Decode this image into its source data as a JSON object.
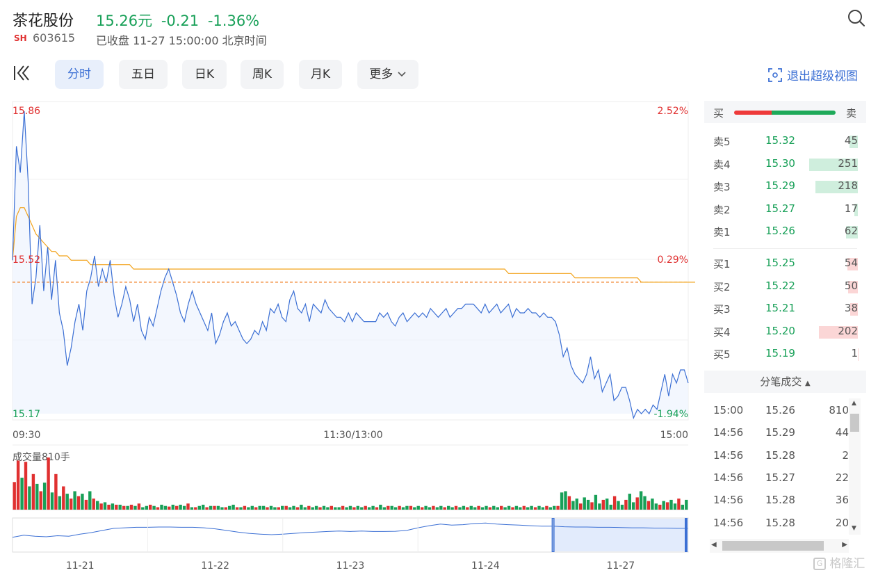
{
  "header": {
    "name": "茶花股份",
    "price": "15.26元",
    "change": "-0.21",
    "change_pct": "-1.36%",
    "exchange": "SH",
    "code": "603615",
    "status": "已收盘 11-27 15:00:00 北京时间"
  },
  "tabs": [
    "分时",
    "五日",
    "日K",
    "周K",
    "月K",
    "更多"
  ],
  "exit_label": "退出超级视图",
  "colors": {
    "up": "#e03030",
    "down": "#18a058",
    "line": "#3b6fd4",
    "avg": "#f2a31b"
  },
  "chart_data": [
    {
      "type": "line",
      "title": "",
      "y_labels_left": [
        "15.86",
        "15.52",
        "15.17"
      ],
      "y_labels_right": [
        "2.52%",
        "0.29%",
        "-1.94%"
      ],
      "ylim": [
        15.17,
        15.86
      ],
      "prev_close": 15.47,
      "x_ticks": [
        "09:30",
        "11:30/13:00",
        "15:00"
      ],
      "series": [
        {
          "values": [
            15.52,
            15.78,
            15.72,
            15.86,
            15.7,
            15.42,
            15.48,
            15.6,
            15.45,
            15.55,
            15.43,
            15.52,
            15.4,
            15.36,
            15.28,
            15.32,
            15.38,
            15.42,
            15.36,
            15.45,
            15.48,
            15.53,
            15.46,
            15.5,
            15.47,
            15.52,
            15.44,
            15.39,
            15.42,
            15.46,
            15.43,
            15.38,
            15.42,
            15.36,
            15.34,
            15.39,
            15.37,
            15.41,
            15.45,
            15.48,
            15.5,
            15.47,
            15.44,
            15.4,
            15.38,
            15.42,
            15.45,
            15.42,
            15.4,
            15.38,
            15.36,
            15.4,
            15.33,
            15.35,
            15.38,
            15.4,
            15.37,
            15.38,
            15.36,
            15.34,
            15.33,
            15.34,
            15.36,
            15.35,
            15.38,
            15.36,
            15.41,
            15.4,
            15.42,
            15.39,
            15.38,
            15.43,
            15.45,
            15.41,
            15.4,
            15.42,
            15.38,
            15.42,
            15.41,
            15.4,
            15.43,
            15.41,
            15.4,
            15.39,
            15.39,
            15.38,
            15.4,
            15.38,
            15.4,
            15.39,
            15.38,
            15.38,
            15.38,
            15.38,
            15.4,
            15.39,
            15.4,
            15.38,
            15.37,
            15.39,
            15.4,
            15.38,
            15.39,
            15.4,
            15.39,
            15.4,
            15.39,
            15.41,
            15.4,
            15.39,
            15.4,
            15.41,
            15.39,
            15.4,
            15.41,
            15.41,
            15.42,
            15.42,
            15.42,
            15.41,
            15.4,
            15.42,
            15.4,
            15.41,
            15.42,
            15.4,
            15.41,
            15.42,
            15.39,
            15.41,
            15.4,
            15.4,
            15.41,
            15.4,
            15.4,
            15.39,
            15.4,
            15.39,
            15.39,
            15.38,
            15.35,
            15.3,
            15.32,
            15.28,
            15.26,
            15.25,
            15.24,
            15.26,
            15.3,
            15.25,
            15.27,
            15.22,
            15.24,
            15.26,
            15.2,
            15.21,
            15.23,
            15.23,
            15.2,
            15.16,
            15.18,
            15.17,
            15.18,
            15.17,
            15.19,
            15.18,
            15.22,
            15.26,
            15.21,
            15.26,
            15.24,
            15.27,
            15.27,
            15.24
          ]
        },
        {
          "values": [
            15.52,
            15.62,
            15.64,
            15.64,
            15.62,
            15.6,
            15.58,
            15.57,
            15.56,
            15.55,
            15.54,
            15.54,
            15.53,
            15.53,
            15.53,
            15.52,
            15.52,
            15.52,
            15.52,
            15.52,
            15.51,
            15.51,
            15.51,
            15.51,
            15.51,
            15.51,
            15.51,
            15.51,
            15.51,
            15.51,
            15.51,
            15.5,
            15.5,
            15.5,
            15.5,
            15.5,
            15.5,
            15.5,
            15.5,
            15.5,
            15.5,
            15.5,
            15.5,
            15.5,
            15.5,
            15.5,
            15.5,
            15.5,
            15.5,
            15.5,
            15.5,
            15.5,
            15.5,
            15.5,
            15.5,
            15.5,
            15.5,
            15.5,
            15.5,
            15.5,
            15.5,
            15.5,
            15.5,
            15.5,
            15.5,
            15.5,
            15.5,
            15.5,
            15.5,
            15.5,
            15.5,
            15.5,
            15.5,
            15.5,
            15.5,
            15.5,
            15.5,
            15.5,
            15.5,
            15.5,
            15.5,
            15.5,
            15.5,
            15.5,
            15.5,
            15.5,
            15.5,
            15.5,
            15.5,
            15.5,
            15.5,
            15.5,
            15.5,
            15.5,
            15.5,
            15.5,
            15.5,
            15.5,
            15.5,
            15.5,
            15.5,
            15.5,
            15.5,
            15.5,
            15.5,
            15.5,
            15.5,
            15.5,
            15.5,
            15.5,
            15.5,
            15.5,
            15.5,
            15.5,
            15.5,
            15.5,
            15.5,
            15.5,
            15.5,
            15.5,
            15.5,
            15.5,
            15.5,
            15.5,
            15.5,
            15.5,
            15.5,
            15.49,
            15.49,
            15.49,
            15.49,
            15.49,
            15.49,
            15.49,
            15.49,
            15.49,
            15.49,
            15.49,
            15.49,
            15.49,
            15.49,
            15.49,
            15.49,
            15.49,
            15.48,
            15.48,
            15.48,
            15.48,
            15.48,
            15.48,
            15.48,
            15.48,
            15.48,
            15.48,
            15.48,
            15.48,
            15.48,
            15.48,
            15.48,
            15.48,
            15.48,
            15.47,
            15.47,
            15.47,
            15.47,
            15.47,
            15.47,
            15.47,
            15.47,
            15.47,
            15.47,
            15.47,
            15.47,
            15.47,
            15.47,
            15.47,
            15.47
          ]
        }
      ]
    },
    {
      "type": "bar",
      "title": "成交量810手",
      "values": [
        45,
        80,
        52,
        78,
        38,
        58,
        42,
        30,
        44,
        85,
        28,
        58,
        22,
        38,
        26,
        18,
        30,
        22,
        26,
        16,
        30,
        18,
        14,
        10,
        12,
        8,
        10,
        8,
        8,
        6,
        6,
        8,
        6,
        10,
        4,
        6,
        8,
        6,
        4,
        8,
        6,
        5,
        8,
        6,
        8,
        6,
        10,
        4,
        4,
        6,
        8,
        4,
        6,
        6,
        6,
        4,
        4,
        6,
        8,
        4,
        4,
        6,
        4,
        6,
        4,
        6,
        6,
        4,
        6,
        4,
        4,
        6,
        6,
        4,
        6,
        4,
        8,
        4,
        6,
        4,
        6,
        4,
        6,
        4,
        6,
        4,
        4,
        6,
        4,
        6,
        4,
        6,
        4,
        6,
        4,
        6,
        4,
        8,
        4,
        6,
        6,
        4,
        6,
        4,
        6,
        6,
        4,
        6,
        4,
        6,
        4,
        6,
        4,
        6,
        4,
        6,
        4,
        6,
        4,
        6,
        4,
        6,
        4,
        6,
        4,
        6,
        4,
        6,
        4,
        6,
        4,
        6,
        4,
        6,
        4,
        6,
        4,
        6,
        4,
        6,
        4,
        6,
        4,
        6,
        6,
        28,
        30,
        22,
        14,
        18,
        10,
        20,
        16,
        12,
        24,
        10,
        16,
        18,
        8,
        22,
        14,
        8,
        16,
        26,
        12,
        20,
        30,
        22,
        14,
        18,
        10,
        8,
        14,
        12,
        16,
        10,
        18,
        8,
        16
      ],
      "up": [
        1,
        1,
        0,
        1,
        0,
        1,
        0,
        1,
        0,
        1,
        0,
        1,
        0,
        1,
        0,
        1,
        0,
        1,
        0,
        1,
        0,
        1,
        0,
        1,
        0,
        1,
        0,
        1,
        0,
        1,
        0,
        1,
        0,
        1,
        0,
        0,
        1,
        0,
        1,
        0,
        0,
        1,
        0,
        1,
        0,
        0,
        1,
        0,
        1,
        0,
        0,
        1,
        0,
        1,
        0,
        0,
        1,
        0,
        0,
        1,
        0,
        1,
        0,
        0,
        1,
        0,
        0,
        1,
        0,
        0,
        1,
        0,
        1,
        0,
        0,
        1,
        0,
        0,
        1,
        0,
        0,
        1,
        0,
        0,
        1,
        0,
        0,
        1,
        0,
        0,
        1,
        0,
        0,
        1,
        0,
        0,
        1,
        0,
        0,
        1,
        0,
        0,
        1,
        0,
        0,
        1,
        0,
        0,
        1,
        0,
        0,
        1,
        0,
        0,
        1,
        0,
        0,
        1,
        0,
        0,
        1,
        0,
        0,
        1,
        0,
        0,
        1,
        0,
        0,
        1,
        0,
        0,
        1,
        0,
        0,
        1,
        0,
        0,
        1,
        0,
        0,
        1,
        0,
        0,
        1,
        0,
        0,
        1,
        0,
        0,
        1,
        0,
        0,
        1,
        0,
        0,
        1,
        0,
        0,
        1,
        0,
        0,
        1,
        0,
        0,
        1,
        0,
        0,
        1,
        0,
        0,
        1,
        0,
        1,
        0,
        0,
        1,
        0,
        0,
        0,
        0
      ]
    },
    {
      "type": "line",
      "x_ticks": [
        "11-21",
        "11-22",
        "11-23",
        "11-24",
        "11-27"
      ],
      "values": [
        0.4,
        0.48,
        0.44,
        0.42,
        0.46,
        0.44,
        0.52,
        0.58,
        0.66,
        0.74,
        0.76,
        0.78,
        0.78,
        0.79,
        0.79,
        0.78,
        0.78,
        0.76,
        0.72,
        0.66,
        0.6,
        0.55,
        0.52,
        0.5,
        0.52,
        0.55,
        0.58,
        0.6,
        0.62,
        0.64,
        0.62,
        0.64,
        0.62,
        0.62,
        0.63,
        0.66,
        0.76,
        0.84,
        0.9,
        0.86,
        0.88,
        0.92,
        0.94,
        0.9,
        0.88,
        0.86,
        0.84,
        0.82,
        0.82,
        0.8,
        0.79,
        0.79,
        0.78,
        0.78,
        0.77,
        0.76,
        0.76,
        0.75,
        0.75,
        0.74,
        0.74
      ]
    }
  ],
  "order_book": {
    "buy_label": "买",
    "sell_label": "卖",
    "sell": [
      {
        "label": "卖5",
        "price": "15.32",
        "vol": "45",
        "v": 45
      },
      {
        "label": "卖4",
        "price": "15.30",
        "vol": "251",
        "v": 251
      },
      {
        "label": "卖3",
        "price": "15.29",
        "vol": "218",
        "v": 218
      },
      {
        "label": "卖2",
        "price": "15.27",
        "vol": "17",
        "v": 17
      },
      {
        "label": "卖1",
        "price": "15.26",
        "vol": "62",
        "v": 62
      }
    ],
    "buy": [
      {
        "label": "买1",
        "price": "15.25",
        "vol": "54",
        "v": 54
      },
      {
        "label": "买2",
        "price": "15.22",
        "vol": "50",
        "v": 50
      },
      {
        "label": "买3",
        "price": "15.21",
        "vol": "38",
        "v": 38
      },
      {
        "label": "买4",
        "price": "15.20",
        "vol": "202",
        "v": 202
      },
      {
        "label": "买5",
        "price": "15.19",
        "vol": "1",
        "v": 1
      }
    ]
  },
  "trades": {
    "title": "分笔成交",
    "rows": [
      {
        "time": "15:00",
        "price": "15.26",
        "vol": "810"
      },
      {
        "time": "14:56",
        "price": "15.29",
        "vol": "44"
      },
      {
        "time": "14:56",
        "price": "15.28",
        "vol": "2"
      },
      {
        "time": "14:56",
        "price": "15.27",
        "vol": "22"
      },
      {
        "time": "14:56",
        "price": "15.28",
        "vol": "36"
      },
      {
        "time": "14:56",
        "price": "15.28",
        "vol": "20"
      }
    ]
  },
  "watermark": "格隆汇"
}
